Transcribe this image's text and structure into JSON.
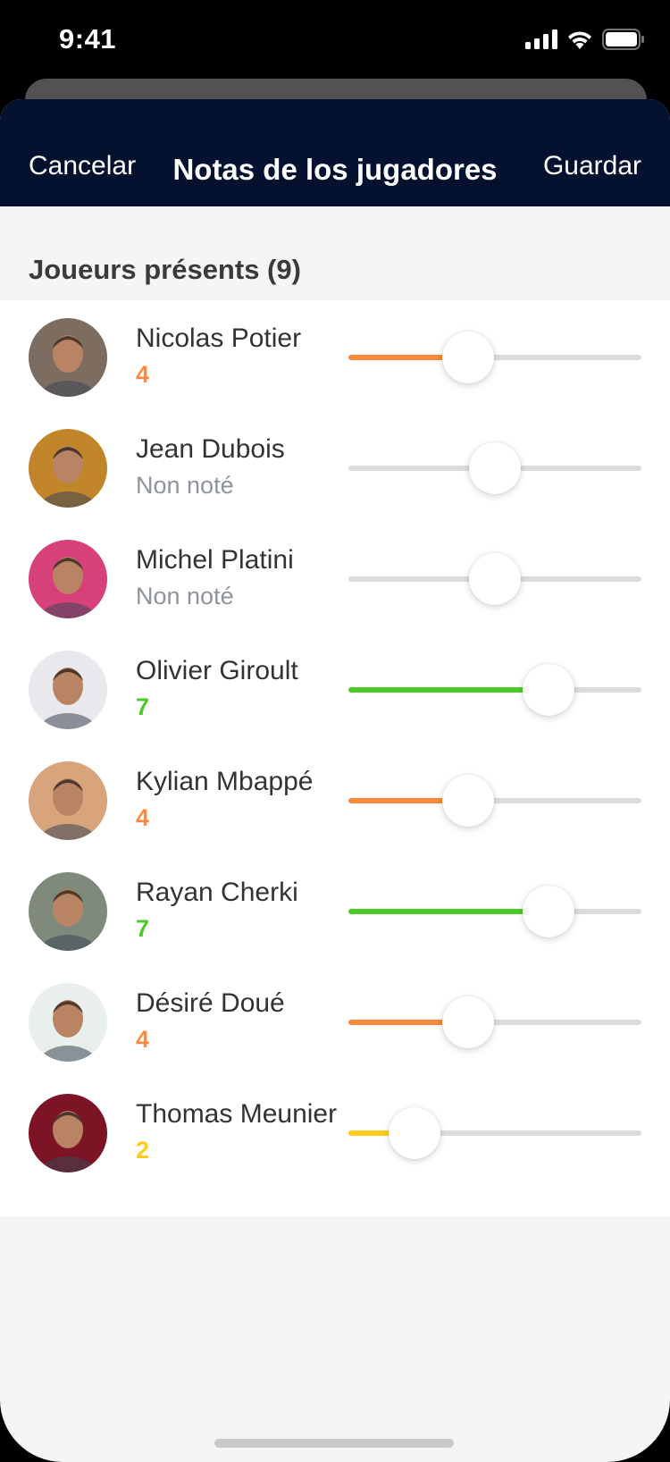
{
  "status": {
    "time": "9:41"
  },
  "nav": {
    "cancel": "Cancelar",
    "title": "Notas de los jugadores",
    "save": "Guardar"
  },
  "section": {
    "title": "Joueurs présents (9)"
  },
  "scale": {
    "min": 0,
    "max": 10
  },
  "colors": {
    "orange": "#ff8a3d",
    "green": "#4cca2a",
    "yellow": "#ffcc1a",
    "track": "#dcdcdc",
    "unrated": "#8e949b",
    "navy": "#04122f"
  },
  "players": [
    {
      "name": "Nicolas Potier",
      "rating_text": "4",
      "value": 4,
      "rated": true,
      "color": "#ff8a3d",
      "avatar_bg": "#7d6d61"
    },
    {
      "name": "Jean Dubois",
      "rating_text": "Non noté",
      "value": 5,
      "rated": false,
      "color": "#8e949b",
      "avatar_bg": "#c2862a"
    },
    {
      "name": "Michel Platini",
      "rating_text": "Non noté",
      "value": 5,
      "rated": false,
      "color": "#8e949b",
      "avatar_bg": "#d8407a"
    },
    {
      "name": "Olivier Giroult",
      "rating_text": "7",
      "value": 7,
      "rated": true,
      "color": "#4cca2a",
      "avatar_bg": "#e9e9ed"
    },
    {
      "name": "Kylian Mbappé",
      "rating_text": "4",
      "value": 4,
      "rated": true,
      "color": "#ff8a3d",
      "avatar_bg": "#d7a47c"
    },
    {
      "name": "Rayan Cherki",
      "rating_text": "7",
      "value": 7,
      "rated": true,
      "color": "#4cca2a",
      "avatar_bg": "#7f8a7c"
    },
    {
      "name": "Désiré Doué",
      "rating_text": "4",
      "value": 4,
      "rated": true,
      "color": "#ff8a3d",
      "avatar_bg": "#e8efec"
    },
    {
      "name": "Thomas Meunier",
      "rating_text": "2",
      "value": 2,
      "rated": true,
      "color": "#ffcc1a",
      "avatar_bg": "#7c1426"
    }
  ]
}
